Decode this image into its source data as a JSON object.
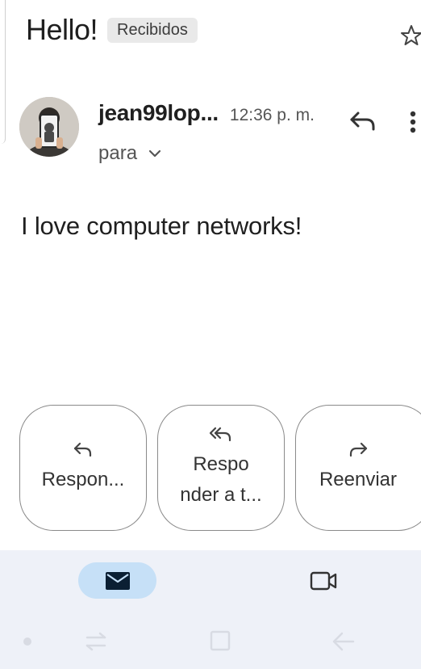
{
  "email": {
    "subject": "Hello!",
    "label": "Recibidos",
    "sender": "jean99lop...",
    "time": "12:36 p. m.",
    "to_label": "para",
    "body": "I love computer networks!"
  },
  "actions": {
    "reply": "Respon...",
    "reply_all_line1": "Respo",
    "reply_all_line2": "nder a t...",
    "forward": "Reenviar"
  },
  "colors": {
    "nav_background": "#eef1f8",
    "active_tab": "#c6e0f7"
  },
  "icons": [
    "star-icon",
    "reply-icon",
    "more-vert-icon",
    "chevron-down-icon",
    "reply-all-icon",
    "forward-icon",
    "mail-icon",
    "video-icon"
  ]
}
